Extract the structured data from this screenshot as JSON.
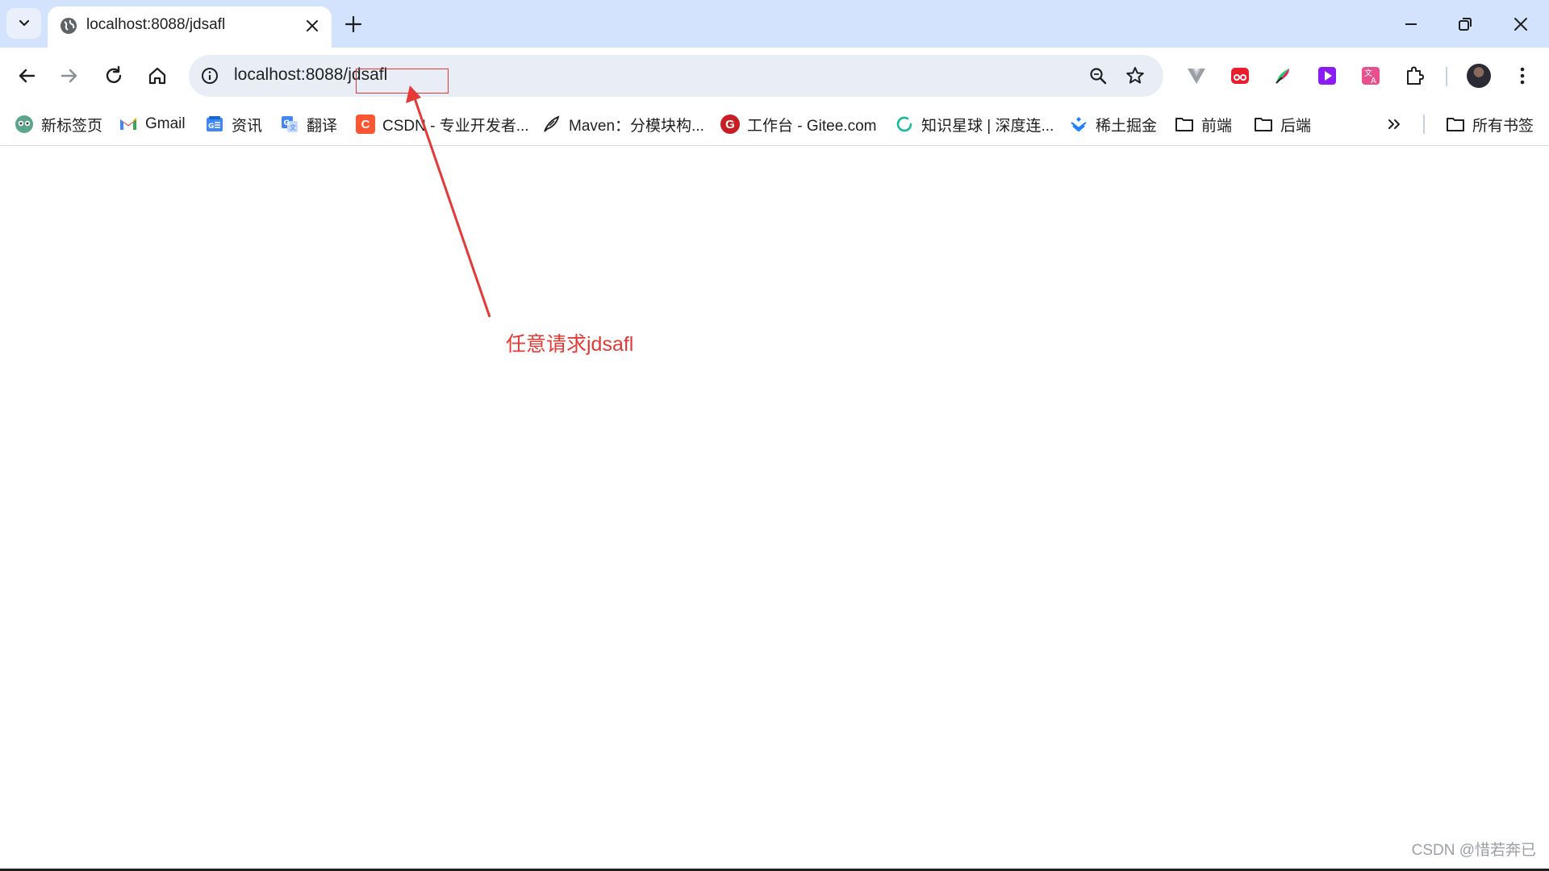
{
  "tab": {
    "title": "localhost:8088/jdsafl"
  },
  "omnibox": {
    "url": "localhost:8088/jdsafl"
  },
  "bookmarks": [
    {
      "label": "新标签页",
      "icon": "new-tab-page-icon"
    },
    {
      "label": "Gmail",
      "icon": "gmail-icon"
    },
    {
      "label": "资讯",
      "icon": "news-icon"
    },
    {
      "label": "翻译",
      "icon": "google-translate-icon"
    },
    {
      "label": "CSDN - 专业开发者...",
      "icon": "csdn-icon",
      "icon_text": "C"
    },
    {
      "label": "Maven：分模块构...",
      "icon": "maven-feather-icon"
    },
    {
      "label": "工作台 - Gitee.com",
      "icon": "gitee-icon",
      "icon_text": "G"
    },
    {
      "label": "知识星球 | 深度连...",
      "icon": "zsxq-icon"
    },
    {
      "label": "稀土掘金",
      "icon": "juejin-icon"
    },
    {
      "label": "前端",
      "icon": "folder-icon"
    },
    {
      "label": "后端",
      "icon": "folder-icon"
    },
    {
      "label": "所有书签",
      "icon": "folder-icon"
    }
  ],
  "annotation": {
    "text": "任意请求jdsafl",
    "color": "#e53935"
  },
  "watermark": {
    "text": "CSDN @惜若奔已"
  },
  "colors": {
    "tabstrip": "#d3e3fd",
    "omnibox": "#e9eef6",
    "accent": "#e53935"
  }
}
